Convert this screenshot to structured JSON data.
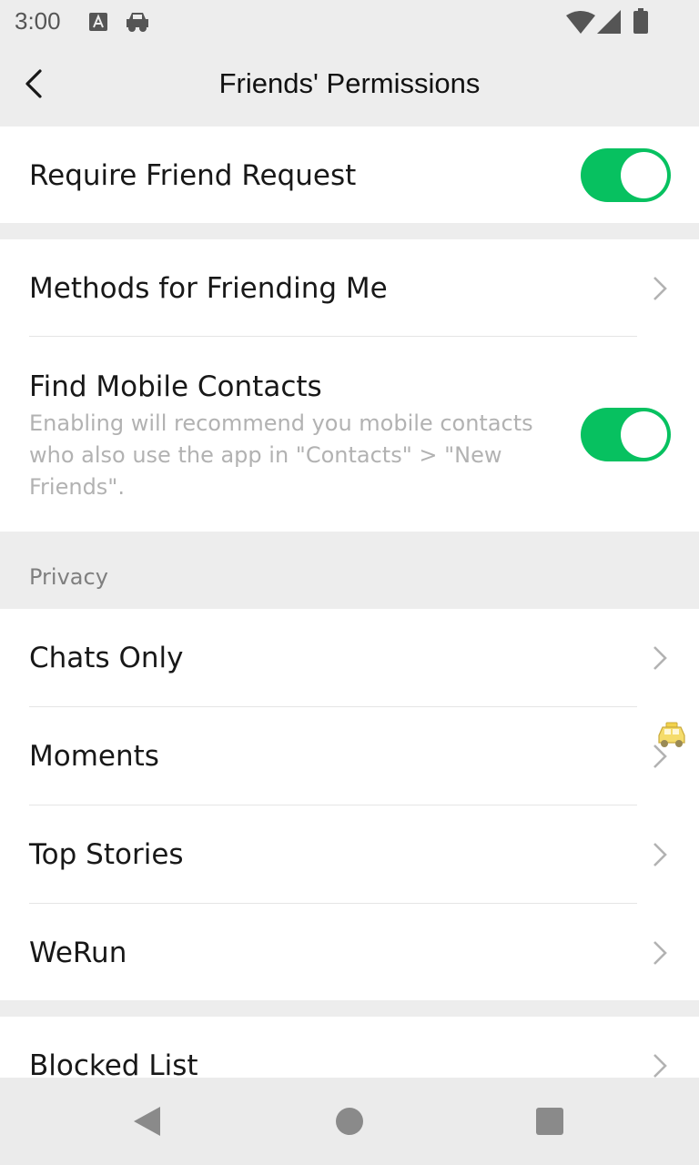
{
  "status_bar": {
    "time": "3:00",
    "icons": [
      "a-notification-icon",
      "car-icon",
      "wifi-icon",
      "signal-icon",
      "battery-icon"
    ]
  },
  "header": {
    "title": "Friends' Permissions",
    "back_icon": "back-arrow-icon"
  },
  "settings": {
    "require_friend_request": {
      "label": "Require Friend Request",
      "enabled": true
    },
    "methods_for_friending": {
      "label": "Methods for Friending Me"
    },
    "find_mobile_contacts": {
      "label": "Find Mobile Contacts",
      "description": "Enabling will recommend you mobile contacts who also use the app in \"Contacts\" > \"New Friends\".",
      "enabled": true
    }
  },
  "privacy": {
    "header": "Privacy",
    "items": [
      {
        "label": "Chats Only"
      },
      {
        "label": "Moments"
      },
      {
        "label": "Top Stories"
      },
      {
        "label": "WeRun"
      }
    ]
  },
  "blocked": {
    "label": "Blocked List"
  },
  "colors": {
    "accent": "#07c160",
    "background": "#ededed",
    "card": "#ffffff",
    "secondary_text": "#b2b2b2"
  },
  "nav_bar": {
    "buttons": [
      "back-triangle-icon",
      "home-circle-icon",
      "recents-square-icon"
    ]
  }
}
